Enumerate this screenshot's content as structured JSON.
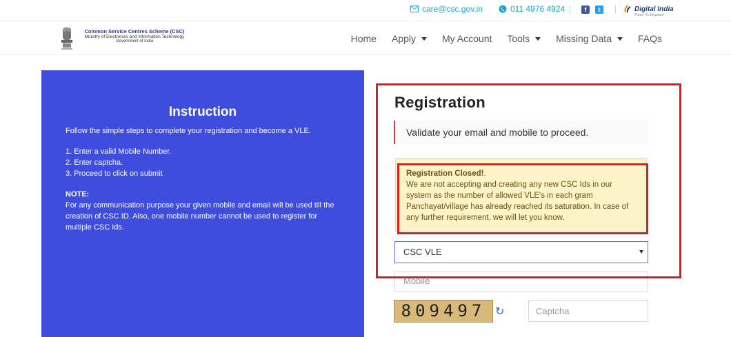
{
  "topbar": {
    "email": "care@csc.gov.in",
    "phone": "011 4976 4924",
    "digital_india": "Digital India",
    "digital_india_tagline": "Power To Empower"
  },
  "brand": {
    "line1": "Common Service Centres Scheme (CSC)",
    "line2": "Ministry of Electronics and Information Technology",
    "line3": "Government of India"
  },
  "nav": {
    "items": [
      {
        "label": "Home",
        "dropdown": false
      },
      {
        "label": "Apply",
        "dropdown": true
      },
      {
        "label": "My Account",
        "dropdown": false
      },
      {
        "label": "Tools",
        "dropdown": true
      },
      {
        "label": "Missing Data",
        "dropdown": true
      },
      {
        "label": "FAQs",
        "dropdown": false
      }
    ]
  },
  "instruction": {
    "title": "Instruction",
    "intro": "Follow the simple steps to complete your registration and become a VLE.",
    "steps": [
      "1. Enter a valid Mobile Number.",
      "2. Enter captcha.",
      "3. Proceed to click on submit"
    ],
    "note_title": "NOTE:",
    "note_text": "For any communication purpose your given mobile and email will be used till the creation of CSC ID. Also, one mobile number cannot be used to register for multiple CSC Ids."
  },
  "registration": {
    "title": "Registration",
    "validate_msg": "Validate your email and mobile to proceed.",
    "closed_title": "Registration Closed!",
    "closed_text": "We are not accepting and creating any new CSC Ids in our system as the number of allowed VLE's in each gram Panchayat/village has already reached its saturation. In case of any further requirement, we will let you know.",
    "select_value": "CSC VLE",
    "mobile_placeholder": "Mobile",
    "captcha_text": "809497",
    "captcha_placeholder": "Captcha"
  },
  "colors": {
    "instruction_bg": "#3f4ddf",
    "accent": "#1aa8c9",
    "annotation": "#d62020",
    "warning_bg": "#fdf3c9"
  }
}
